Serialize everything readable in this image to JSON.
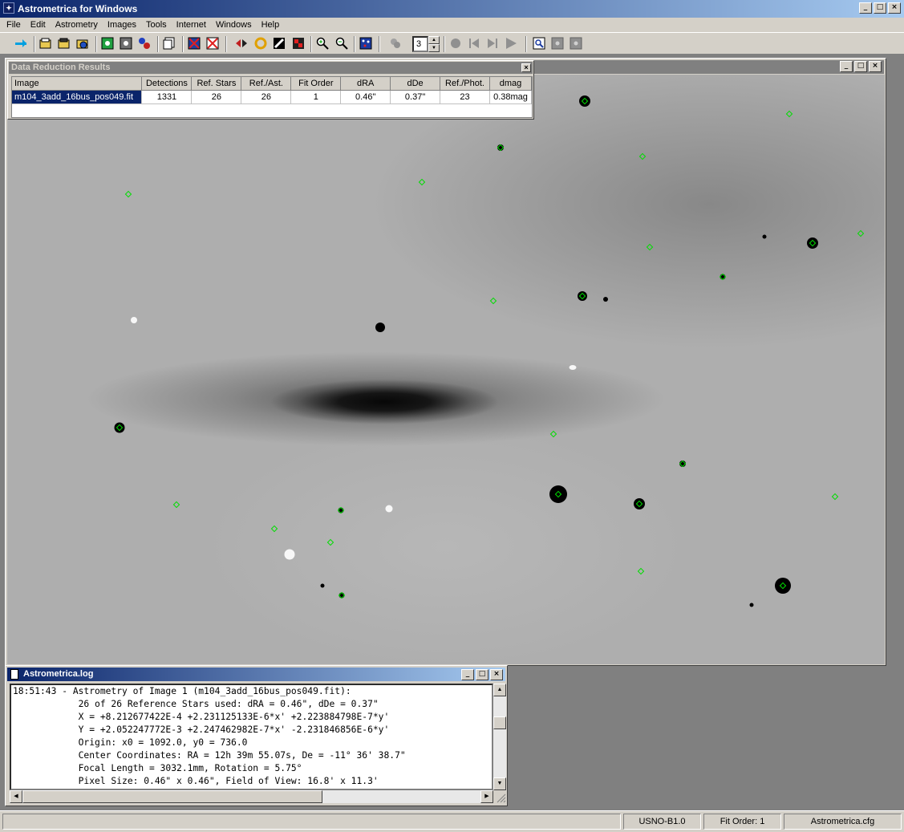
{
  "window": {
    "title": "Astrometrica for Windows",
    "minimize": "_",
    "maximize": "□",
    "close": "×"
  },
  "menu": [
    "File",
    "Edit",
    "Astrometry",
    "Images",
    "Tools",
    "Internet",
    "Windows",
    "Help"
  ],
  "toolbar": {
    "stack_count": "3"
  },
  "results": {
    "title": "Data Reduction Results",
    "close": "×",
    "columns": [
      "Image",
      "Detections",
      "Ref. Stars",
      "Ref./Ast.",
      "Fit Order",
      "dRA",
      "dDe",
      "Ref./Phot.",
      "dmag"
    ],
    "rows": [
      [
        "m104_3add_16bus_pos049.fit",
        "1331",
        "26",
        "26",
        "1",
        "0.46\"",
        "0.37\"",
        "23",
        "0.38mag"
      ]
    ]
  },
  "log": {
    "title": "Astrometrica.log",
    "lines": [
      "18:51:43 - Astrometry of Image 1 (m104_3add_16bus_pos049.fit):",
      "            26 of 26 Reference Stars used: dRA = 0.46\", dDe = 0.37\"",
      "            X = +8.212677422E-4 +2.231125133E-6*x' +2.223884798E-7*y'",
      "            Y = +2.052247772E-3 +2.247462982E-7*x' -2.231846856E-6*y'",
      "            Origin: x0 = 1092.0, y0 = 736.0",
      "            Center Coordinates: RA = 12h 39m 55.07s, De = -11° 36' 38.7\"",
      "            Focal Length = 3032.1mm, Rotation = 5.75°",
      "            Pixel Size: 0.46\" x 0.46\", Field of View: 16.8' x 11.3'"
    ]
  },
  "status": {
    "catalog": "USNO-B1.0",
    "fit_order": "Fit Order: 1",
    "config": "Astrometrica.cfg"
  }
}
